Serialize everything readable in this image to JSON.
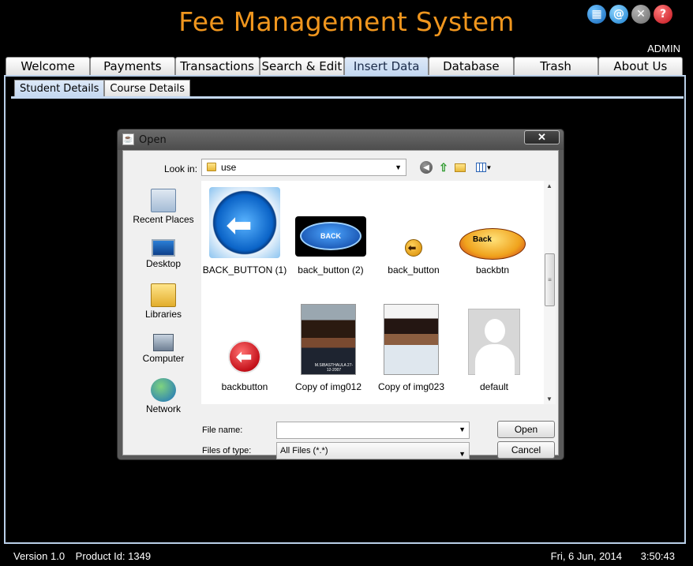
{
  "app": {
    "title": "Fee Management System",
    "user": "ADMIN"
  },
  "top_icons": [
    "grid-icon",
    "at-icon",
    "close-icon",
    "help-icon"
  ],
  "main_tabs": [
    {
      "label": "Welcome",
      "active": false
    },
    {
      "label": "Payments",
      "active": false
    },
    {
      "label": "Transactions",
      "active": false
    },
    {
      "label": "Search & Edit",
      "active": false
    },
    {
      "label": "Insert Data",
      "active": true
    },
    {
      "label": "Database",
      "active": false
    },
    {
      "label": "Trash",
      "active": false
    },
    {
      "label": "About Us",
      "active": false
    }
  ],
  "sub_tabs": [
    {
      "label": "Student Details",
      "active": true
    },
    {
      "label": "Course Details",
      "active": false
    }
  ],
  "dialog": {
    "title": "Open",
    "close_label": "✕",
    "look_in_label": "Look in:",
    "look_in_value": "use",
    "places": [
      "Recent Places",
      "Desktop",
      "Libraries",
      "Computer",
      "Network"
    ],
    "files": [
      {
        "name": "BACK_BUTTON (1)"
      },
      {
        "name": "back_button (2)",
        "thumb_text": "BACK"
      },
      {
        "name": "back_button"
      },
      {
        "name": "backbtn",
        "thumb_text": "Back"
      },
      {
        "name": "backbutton"
      },
      {
        "name": "Copy of img012",
        "thumb_text": "M.SIBASTHAULA  27-12-2007"
      },
      {
        "name": "Copy of img023"
      },
      {
        "name": "default"
      }
    ],
    "file_name_label": "File name:",
    "file_name_value": "",
    "files_of_type_label": "Files of type:",
    "files_of_type_value": "All Files (*.*)",
    "open_button": "Open",
    "cancel_button": "Cancel"
  },
  "status": {
    "version": "Version 1.0",
    "product_id": "Product Id: 1349",
    "date": "Fri, 6 Jun, 2014",
    "time": "3:50:43"
  },
  "colors": {
    "title": "#f0961e",
    "active_tab": "#c4d8f1",
    "background": "#000000"
  }
}
